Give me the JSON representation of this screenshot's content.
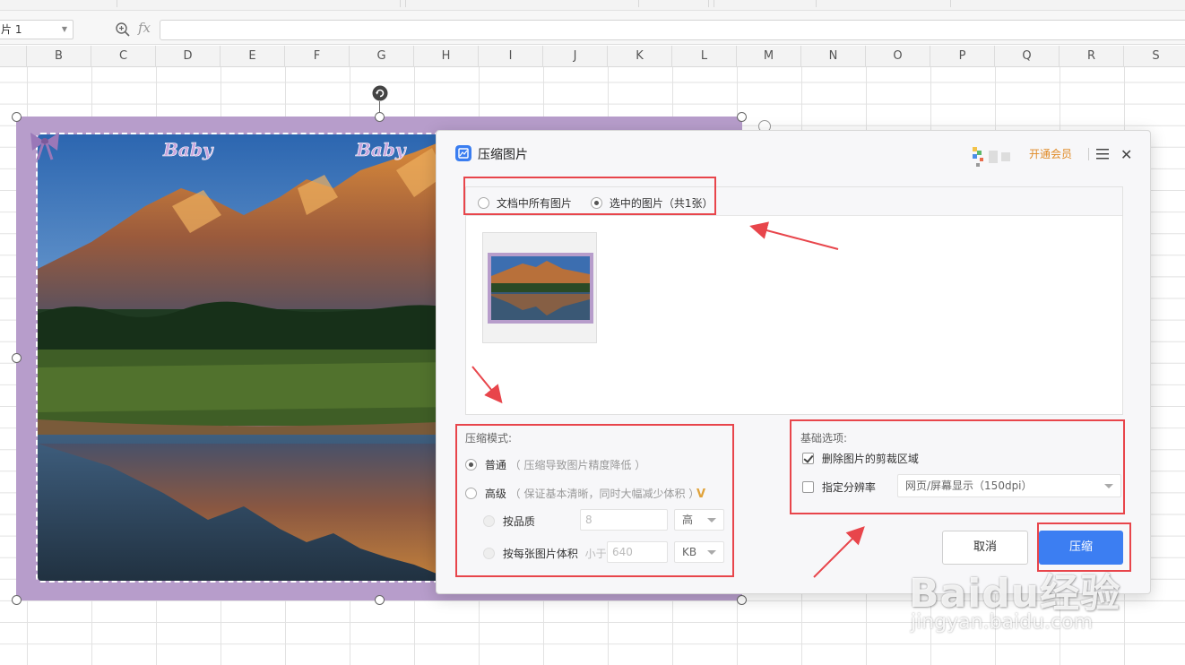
{
  "sheet": {
    "name_box": "片 1",
    "fx_label": "fx",
    "formula_value": "",
    "columns": [
      "B",
      "C",
      "D",
      "E",
      "F",
      "G",
      "H",
      "I",
      "J",
      "K",
      "L",
      "M",
      "N",
      "O",
      "P",
      "Q",
      "R",
      "S"
    ]
  },
  "picture": {
    "brand_text_1": "Baby",
    "brand_text_2": "Baby"
  },
  "dialog": {
    "title": "压缩图片",
    "vip_label": "开通会员",
    "scope": {
      "all_images_label": "文档中所有图片",
      "selected_images_label": "选中的图片（共1张）",
      "selected": "selected_images"
    },
    "mode": {
      "title": "压缩模式:",
      "normal_label": "普通",
      "normal_hint": "（ 压缩导致图片精度降低 ）",
      "advanced_label": "高级",
      "advanced_hint": "（ 保证基本清晰，同时大幅减少体积 ）",
      "selected": "normal",
      "by_quality_label": "按品质",
      "quality_value": "8",
      "quality_select": "高",
      "by_size_label": "按每张图片体积",
      "less_than_label": "小于",
      "size_value": "640",
      "size_unit": "KB"
    },
    "basic": {
      "title": "基础选项:",
      "delete_crop_label": "删除图片的剪裁区域",
      "delete_crop_checked": true,
      "set_resolution_label": "指定分辨率",
      "set_resolution_checked": false,
      "resolution_value": "网页/屏幕显示（150dpi）"
    },
    "cancel_label": "取消",
    "ok_label": "压缩"
  },
  "watermark": {
    "brand": "Baidu经验",
    "url": "jingyan.baidu.com"
  },
  "colors": {
    "accent": "#3c7ef2",
    "annotation": "#e8454b",
    "picture_border": "#b79dcb",
    "vip": "#e08a26"
  }
}
